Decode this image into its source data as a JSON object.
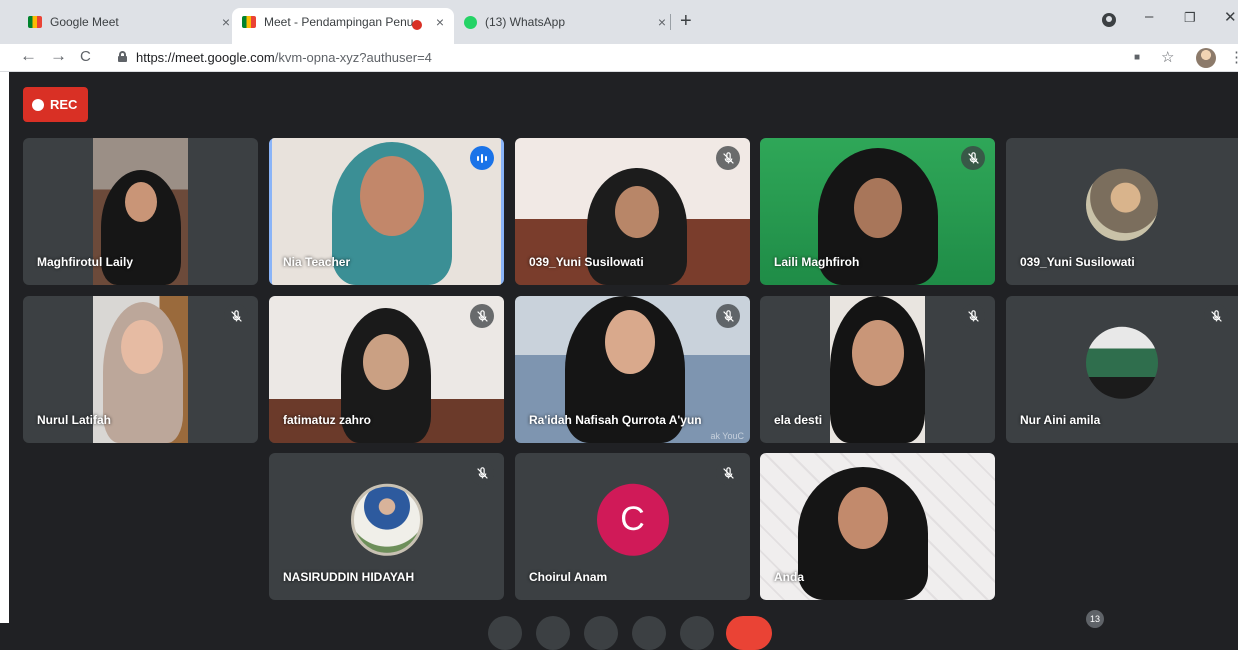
{
  "browser": {
    "tabs": [
      {
        "title": "Google Meet",
        "active": false
      },
      {
        "title": "Meet - Pendampingan Penul",
        "active": true,
        "recording": true
      },
      {
        "title": "(13) WhatsApp",
        "active": false,
        "badge": "13"
      }
    ],
    "close_glyph": "×",
    "new_tab_glyph": "+",
    "window_controls": {
      "minimize": "–",
      "restore": "❐",
      "close": "✕"
    },
    "nav": {
      "back": "←",
      "forward": "→",
      "reload": "C"
    },
    "url_host": "https://meet.google.com",
    "url_path": "/kvm-opna-xyz?authuser=4",
    "toolbar_icons": {
      "camera": "■",
      "star": "☆",
      "menu": "⋮"
    }
  },
  "meeting": {
    "rec_label": "REC",
    "participants_count": "13",
    "tiles": [
      {
        "name": "Maghfirotul Laily",
        "muted": false,
        "speaking": false
      },
      {
        "name": "Nia Teacher",
        "muted": false,
        "speaking": true
      },
      {
        "name": "039_Yuni Susilowati",
        "muted": true,
        "speaking": false
      },
      {
        "name": "Laili Maghfiroh",
        "muted": true,
        "speaking": false
      },
      {
        "name": "039_Yuni Susilowati",
        "muted": false,
        "speaking": false,
        "avatar": true
      },
      {
        "name": "Nurul Latifah",
        "muted": true,
        "speaking": false
      },
      {
        "name": "fatimatuz zahro",
        "muted": true,
        "speaking": false
      },
      {
        "name": "Ra'idah Nafisah Qurrota A'yun",
        "muted": true,
        "speaking": false,
        "watermark": "ak YouC"
      },
      {
        "name": "ela desti",
        "muted": true,
        "speaking": false
      },
      {
        "name": "Nur Aini amila",
        "muted": true,
        "speaking": false,
        "avatar": true
      },
      {
        "name": "NASIRUDDIN HIDAYAH",
        "muted": true,
        "speaking": false,
        "avatar": true
      },
      {
        "name": "Choirul Anam",
        "muted": true,
        "speaking": false,
        "letter": "C"
      },
      {
        "name": "Anda",
        "muted": false,
        "speaking": false
      }
    ]
  },
  "colors": {
    "meet_bg": "#202124",
    "tile_bg": "#3c4043",
    "rec_red": "#d93025",
    "speaking_blue": "#1a73e8",
    "letter_avatar": "#d01a58"
  }
}
